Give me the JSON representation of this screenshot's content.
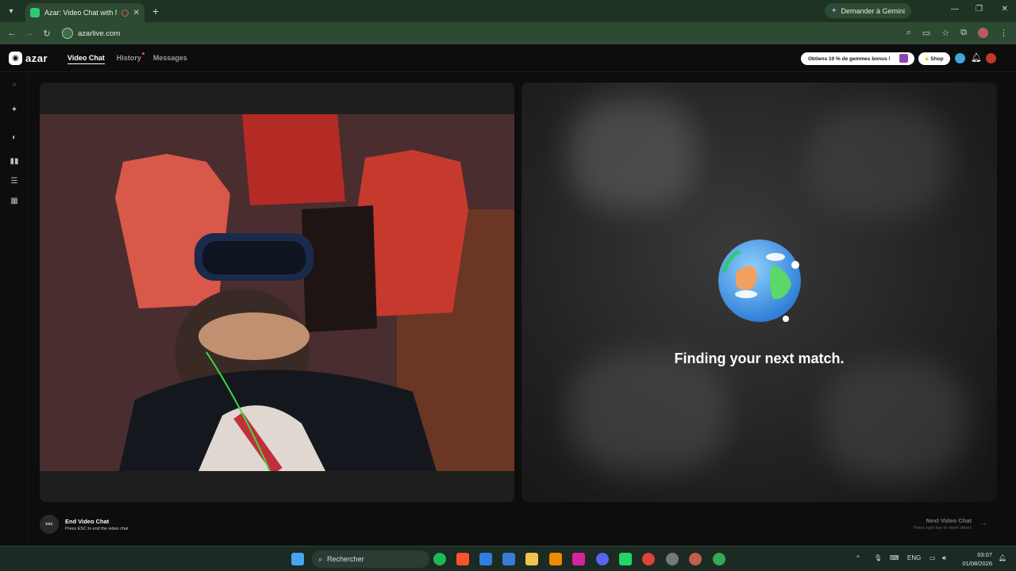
{
  "browser": {
    "tab_title": "Azar: Video Chat with New",
    "gemini_label": "Demander à Gemini",
    "url": "azarlive.com"
  },
  "app": {
    "logo": "azar",
    "nav": [
      {
        "label": "Video Chat",
        "active": true
      },
      {
        "label": "History",
        "active": false,
        "has_dot": true
      },
      {
        "label": "Messages",
        "active": false
      }
    ],
    "promo_label": "Obtiens 10 % de gemmes bonus !",
    "shop_label": "Shop"
  },
  "left_rail_icons": [
    "chevrons-right-icon",
    "magic-wand-icon",
    "filter-icon",
    "layout-columns-icon",
    "layout-rows-icon",
    "layout-grid-icon"
  ],
  "match_panel": {
    "status": "Finding your next match."
  },
  "footer": {
    "esc_label": "esc",
    "end_title": "End Video Chat",
    "end_sub": "Press ESC to end the video chat",
    "next_title": "Next Video Chat",
    "next_sub": "Press right key to meet others"
  },
  "taskbar": {
    "search_placeholder": "Rechercher",
    "lang": "ENG",
    "time": "03:07",
    "date": "01/08/2026"
  },
  "colors": {
    "browser_frame": "#1f3324",
    "address_bar": "#2d4a33",
    "app_bg": "#0d0d0d",
    "accent_green": "#2ecc71"
  }
}
